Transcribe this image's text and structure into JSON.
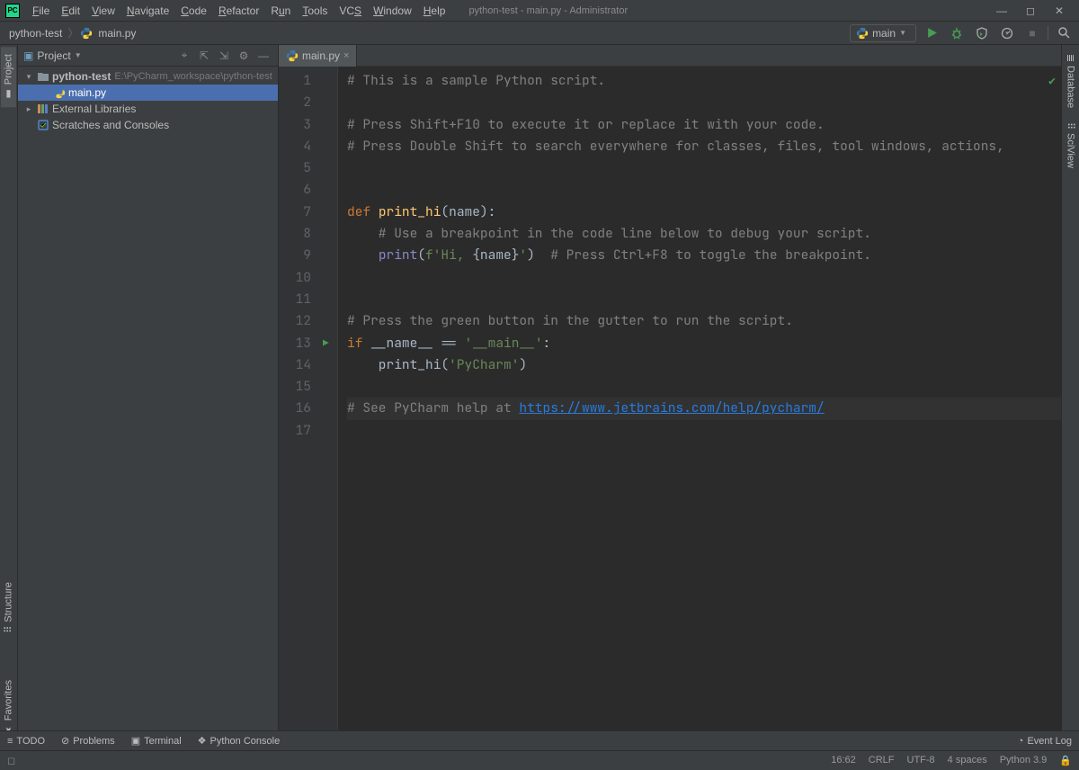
{
  "window": {
    "title": "python-test - main.py - Administrator"
  },
  "menu": [
    "File",
    "Edit",
    "View",
    "Navigate",
    "Code",
    "Refactor",
    "Run",
    "Tools",
    "VCS",
    "Window",
    "Help"
  ],
  "breadcrumb": {
    "project": "python-test",
    "file": "main.py"
  },
  "run_config": {
    "label": "main"
  },
  "project_panel": {
    "title": "Project",
    "root": {
      "name": "python-test",
      "path": "E:\\PyCharm_workspace\\python-test"
    },
    "file": "main.py",
    "ext_libs": "External Libraries",
    "scratches": "Scratches and Consoles"
  },
  "editor": {
    "tab": "main.py",
    "lines": [
      {
        "n": 1,
        "t": "comment",
        "text": "# This is a sample Python script."
      },
      {
        "n": 2,
        "t": "",
        "text": ""
      },
      {
        "n": 3,
        "t": "comment",
        "text": "# Press Shift+F10 to execute it or replace it with your code."
      },
      {
        "n": 4,
        "t": "comment",
        "text": "# Press Double Shift to search everywhere for classes, files, tool windows, actions,"
      },
      {
        "n": 5,
        "t": "",
        "text": ""
      },
      {
        "n": 6,
        "t": "",
        "text": ""
      },
      {
        "n": 7,
        "t": "def",
        "text": "def print_hi(name):"
      },
      {
        "n": 8,
        "t": "comment",
        "text": "    # Use a breakpoint in the code line below to debug your script."
      },
      {
        "n": 9,
        "t": "print",
        "text": "    print(f'Hi, {name}')  # Press Ctrl+F8 to toggle the breakpoint."
      },
      {
        "n": 10,
        "t": "",
        "text": ""
      },
      {
        "n": 11,
        "t": "",
        "text": ""
      },
      {
        "n": 12,
        "t": "comment",
        "text": "# Press the green button in the gutter to run the script."
      },
      {
        "n": 13,
        "t": "if",
        "text": "if __name__ == '__main__':"
      },
      {
        "n": 14,
        "t": "call",
        "text": "    print_hi('PyCharm')"
      },
      {
        "n": 15,
        "t": "",
        "text": ""
      },
      {
        "n": 16,
        "t": "link",
        "text": "# See PyCharm help at https://www.jetbrains.com/help/pycharm/",
        "link": "https://www.jetbrains.com/help/pycharm/"
      },
      {
        "n": 17,
        "t": "",
        "text": ""
      }
    ],
    "run_gutter_line": 13,
    "highlighted_line": 16
  },
  "left_tabs": {
    "top1": "Project",
    "bottom1": "Structure",
    "bottom2": "Favorites"
  },
  "right_tabs": {
    "top1": "Database",
    "top2": "SciView"
  },
  "bottom_tools": {
    "todo": "TODO",
    "problems": "Problems",
    "terminal": "Terminal",
    "pyconsole": "Python Console",
    "eventlog": "Event Log"
  },
  "status": {
    "caret": "16:62",
    "eol": "CRLF",
    "encoding": "UTF-8",
    "indent": "4 spaces",
    "python": "Python 3.9"
  }
}
